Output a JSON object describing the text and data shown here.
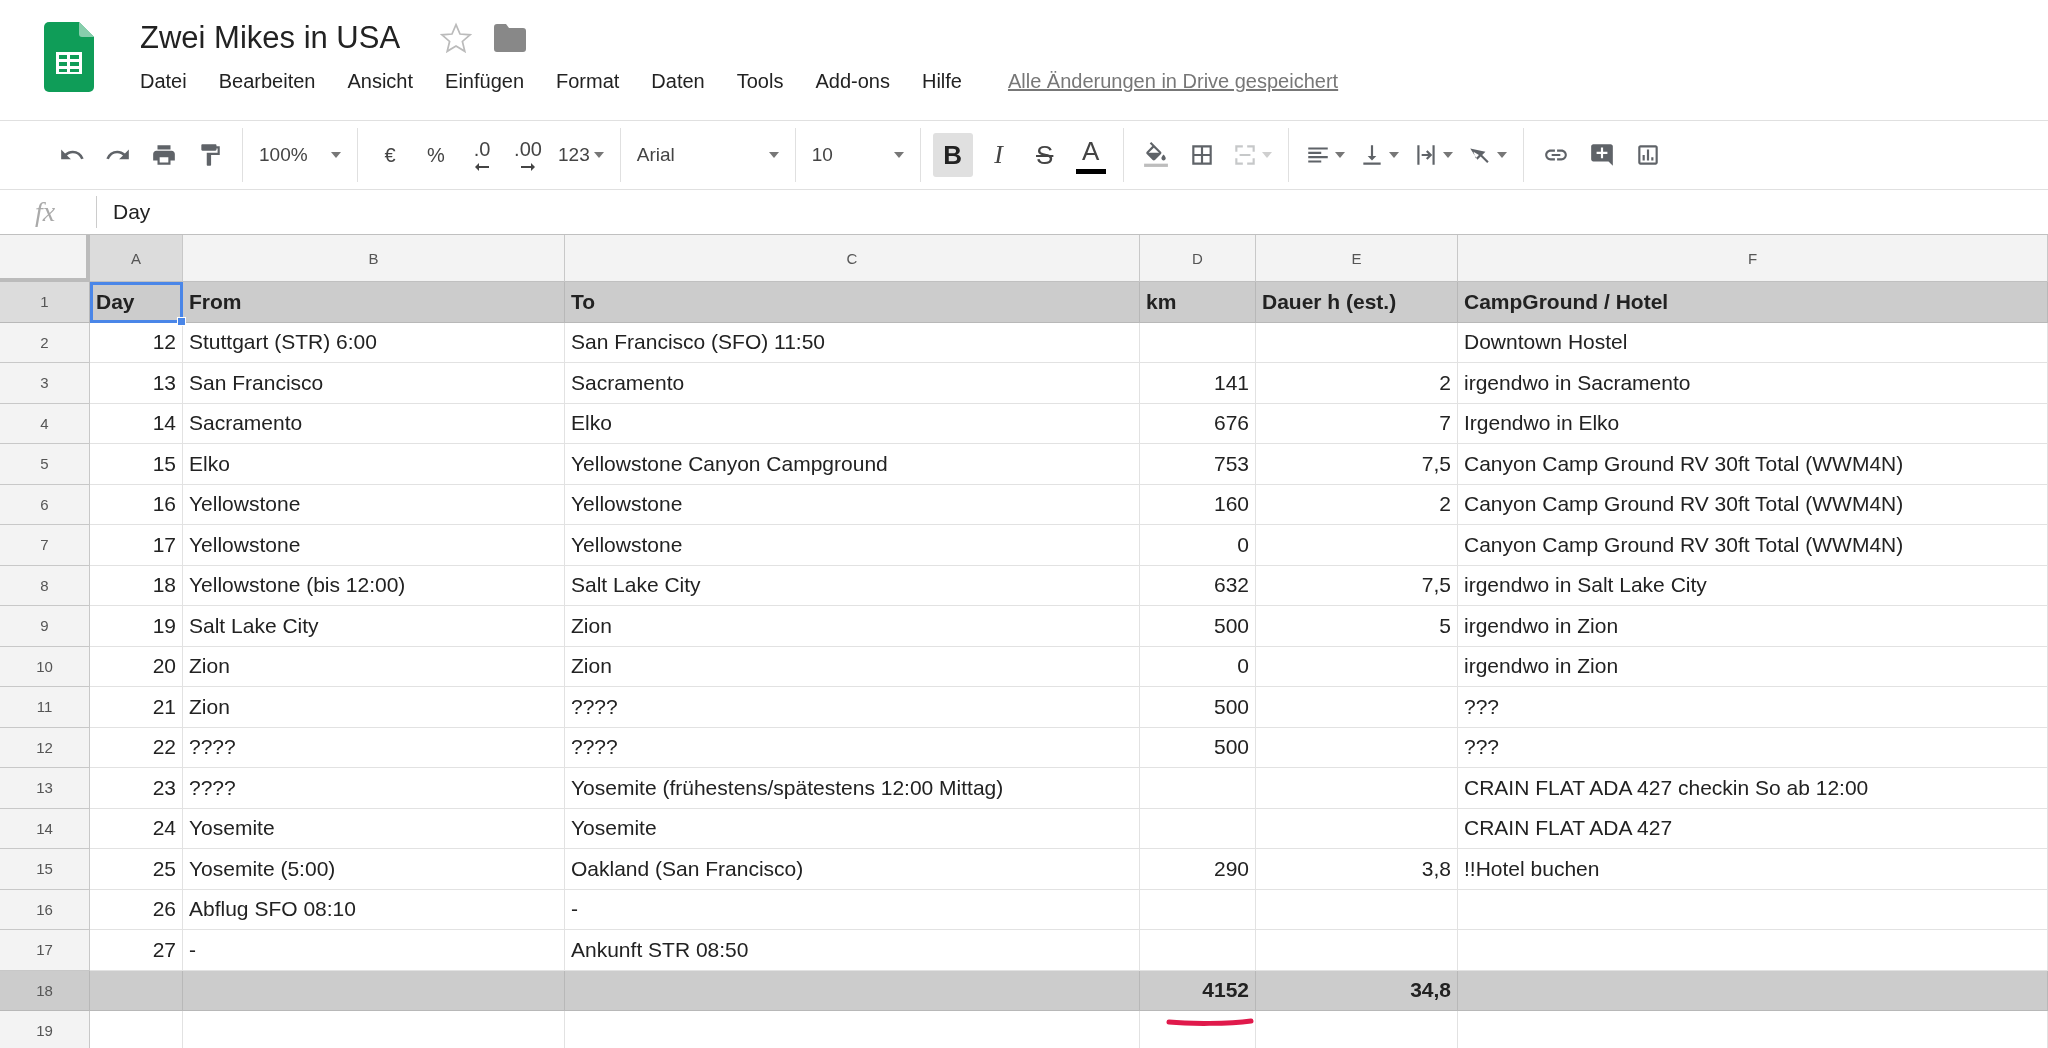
{
  "app": {
    "title": "Zwei Mikes in USA",
    "starred": false,
    "menu": [
      "Datei",
      "Bearbeiten",
      "Ansicht",
      "Einfügen",
      "Format",
      "Daten",
      "Tools",
      "Add-ons",
      "Hilfe"
    ],
    "save_status": "Alle Änderungen in Drive gespeichert"
  },
  "toolbar": [
    [
      {
        "kind": "undo"
      },
      {
        "kind": "redo"
      },
      {
        "kind": "print"
      },
      {
        "kind": "paint-format"
      }
    ],
    [
      {
        "kind": "select",
        "label": "100%"
      }
    ],
    [
      {
        "kind": "text",
        "label": "€"
      },
      {
        "kind": "text",
        "label": "%"
      },
      {
        "kind": "decimal-less",
        "label": ".0"
      },
      {
        "kind": "decimal-more",
        "label": ".00"
      },
      {
        "kind": "select",
        "label": "123"
      }
    ],
    [
      {
        "kind": "font",
        "label": "Arial"
      }
    ],
    [
      {
        "kind": "size",
        "label": "10"
      }
    ],
    [
      {
        "kind": "bold",
        "label": "B",
        "selected": true
      },
      {
        "kind": "italic",
        "label": "I",
        "selected": false
      },
      {
        "kind": "strike",
        "label": "S",
        "selected": false
      },
      {
        "kind": "text-color",
        "label": "A"
      }
    ],
    [
      {
        "kind": "fill-color",
        "disabled": false
      },
      {
        "kind": "borders",
        "disabled": false
      },
      {
        "kind": "merge",
        "disabled": true
      }
    ],
    [
      {
        "kind": "align"
      },
      {
        "kind": "valign"
      },
      {
        "kind": "wrap"
      },
      {
        "kind": "rotate"
      }
    ],
    [
      {
        "kind": "link"
      },
      {
        "kind": "comment"
      },
      {
        "kind": "chart"
      }
    ]
  ],
  "formula_bar": {
    "label": "fx",
    "value": "Day"
  },
  "columns": [
    {
      "label": "A",
      "selected": true
    },
    {
      "label": "B",
      "selected": false
    },
    {
      "label": "C",
      "selected": false
    },
    {
      "label": "D",
      "selected": false
    },
    {
      "label": "E",
      "selected": false
    },
    {
      "label": "F",
      "selected": false
    }
  ],
  "rows": [
    {
      "number": "1",
      "kind": "header",
      "selected": true,
      "cells": [
        "Day",
        "From",
        "To",
        "km",
        "Dauer h (est.)",
        "CampGround / Hotel"
      ]
    },
    {
      "number": "2",
      "kind": "data",
      "selected": false,
      "cells": [
        "12",
        "Stuttgart (STR) 6:00",
        "San Francisco (SFO) 11:50",
        null,
        null,
        "Downtown Hostel"
      ]
    },
    {
      "number": "3",
      "kind": "data",
      "selected": false,
      "cells": [
        "13",
        "San Francisco",
        "Sacramento",
        "141",
        "2",
        "irgendwo in Sacramento"
      ]
    },
    {
      "number": "4",
      "kind": "data",
      "selected": false,
      "cells": [
        "14",
        "Sacramento",
        "Elko",
        "676",
        "7",
        "Irgendwo in Elko"
      ]
    },
    {
      "number": "5",
      "kind": "data",
      "selected": false,
      "cells": [
        "15",
        "Elko",
        "Yellowstone Canyon Campground",
        "753",
        "7,5",
        "Canyon Camp Ground RV 30ft Total (WWM4N)"
      ]
    },
    {
      "number": "6",
      "kind": "data",
      "selected": false,
      "cells": [
        "16",
        "Yellowstone",
        "Yellowstone",
        "160",
        "2",
        "Canyon Camp Ground RV 30ft Total (WWM4N)"
      ]
    },
    {
      "number": "7",
      "kind": "data",
      "selected": false,
      "cells": [
        "17",
        "Yellowstone",
        "Yellowstone",
        "0",
        null,
        "Canyon Camp Ground RV 30ft Total (WWM4N)"
      ]
    },
    {
      "number": "8",
      "kind": "data",
      "selected": false,
      "cells": [
        "18",
        "Yellowstone (bis 12:00)",
        "Salt Lake City",
        "632",
        "7,5",
        "irgendwo in Salt Lake City"
      ]
    },
    {
      "number": "9",
      "kind": "data",
      "selected": false,
      "cells": [
        "19",
        "Salt Lake City",
        "Zion",
        "500",
        "5",
        "irgendwo in Zion"
      ]
    },
    {
      "number": "10",
      "kind": "data",
      "selected": false,
      "cells": [
        "20",
        "Zion",
        "Zion",
        "0",
        null,
        "irgendwo in Zion"
      ]
    },
    {
      "number": "11",
      "kind": "data",
      "selected": false,
      "cells": [
        "21",
        "Zion",
        "????",
        "500",
        null,
        "???"
      ]
    },
    {
      "number": "12",
      "kind": "data",
      "selected": false,
      "cells": [
        "22",
        "????",
        "????",
        "500",
        null,
        "???"
      ]
    },
    {
      "number": "13",
      "kind": "data",
      "selected": false,
      "cells": [
        "23",
        "????",
        "Yosemite (frühestens/spätestens 12:00 Mittag)",
        null,
        null,
        "CRAIN FLAT ADA 427 checkin So ab 12:00"
      ]
    },
    {
      "number": "14",
      "kind": "data",
      "selected": false,
      "cells": [
        "24",
        "Yosemite",
        "Yosemite",
        null,
        null,
        "CRAIN FLAT ADA 427"
      ]
    },
    {
      "number": "15",
      "kind": "data",
      "selected": false,
      "cells": [
        "25",
        "Yosemite (5:00)",
        "Oakland (San Francisco)",
        "290",
        "3,8",
        "!!Hotel buchen"
      ]
    },
    {
      "number": "16",
      "kind": "data",
      "selected": false,
      "cells": [
        "26",
        "Abflug SFO 08:10",
        "-",
        null,
        null,
        null
      ]
    },
    {
      "number": "17",
      "kind": "data",
      "selected": false,
      "cells": [
        "27",
        "-",
        "Ankunft STR 08:50",
        null,
        null,
        null
      ]
    },
    {
      "number": "18",
      "kind": "total",
      "selected": false,
      "underlined": true,
      "cells": [
        null,
        null,
        null,
        "4152",
        "34,8",
        null
      ]
    },
    {
      "number": "19",
      "kind": "data",
      "selected": false,
      "cells": [
        null,
        null,
        null,
        null,
        null,
        null
      ]
    }
  ]
}
